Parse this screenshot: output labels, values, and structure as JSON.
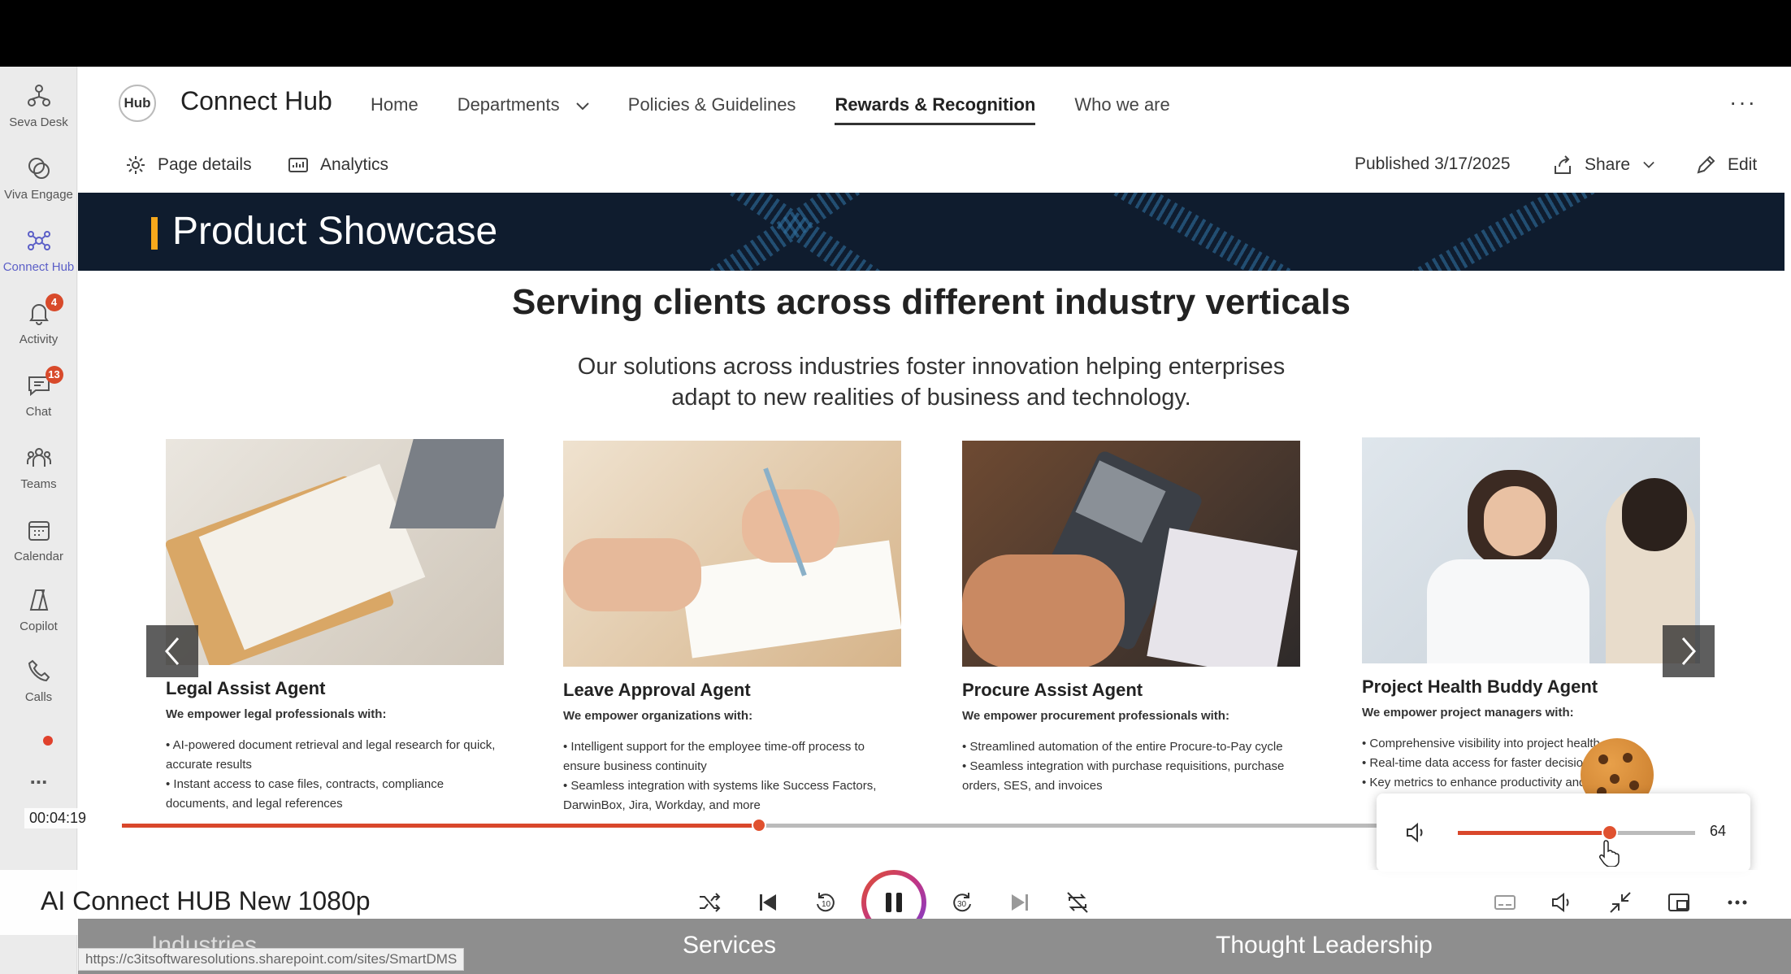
{
  "rail": {
    "items": [
      {
        "label": "Seva Desk"
      },
      {
        "label": "Viva Engage"
      },
      {
        "label": "Connect Hub"
      },
      {
        "label": "Activity",
        "badge": "4"
      },
      {
        "label": "Chat",
        "badge": "13"
      },
      {
        "label": "Teams"
      },
      {
        "label": "Calendar"
      },
      {
        "label": "Copilot"
      },
      {
        "label": "Calls"
      },
      {
        "label": "..."
      }
    ],
    "active": "Connect Hub"
  },
  "site": {
    "logo_text": "Hub",
    "title": "Connect Hub",
    "nav": {
      "home": "Home",
      "departments": "Departments",
      "policies": "Policies & Guidelines",
      "rewards": "Rewards & Recognition",
      "who": "Who we are"
    },
    "more": "···"
  },
  "commandbar": {
    "page_details": "Page details",
    "analytics": "Analytics",
    "published": "Published 3/17/2025",
    "share": "Share",
    "edit": "Edit"
  },
  "banner": {
    "title": "Product Showcase"
  },
  "showcase": {
    "headline": "Serving clients across different industry verticals",
    "subhead_line1": "Our solutions across industries foster innovation helping enterprises",
    "subhead_line2": "adapt to new realities of business and technology.",
    "cards": [
      {
        "title": "Legal Assist Agent",
        "lead": "We empower legal professionals with:",
        "bullets": [
          "AI-powered document retrieval and legal research for quick, accurate results",
          "Instant access to case files, contracts, compliance documents, and legal references"
        ]
      },
      {
        "title": "Leave Approval Agent",
        "lead": "We empower organizations with:",
        "bullets": [
          "Intelligent support for the employee time-off process to ensure business continuity",
          "Seamless integration with systems like Success Factors, DarwinBox, Jira, Workday, and more"
        ]
      },
      {
        "title": "Procure Assist Agent",
        "lead": "We empower procurement professionals with:",
        "bullets": [
          "Streamlined automation of the entire Procure-to-Pay cycle",
          "Seamless integration with purchase requisitions, purchase orders, SES, and invoices"
        ]
      },
      {
        "title": "Project Health Buddy Agent",
        "lead": "We empower project managers with:",
        "bullets": [
          "Comprehensive visibility into project health",
          "Real-time data access for faster decisions",
          "Key metrics to enhance productivity and efficiency"
        ]
      }
    ]
  },
  "player": {
    "current_time": "00:04:19",
    "progress": 0.506,
    "volume": 64,
    "volume_label": "64",
    "title": "AI Connect HUB New 1080p",
    "skip_back_label": "10",
    "skip_forward_label": "30"
  },
  "footer": {
    "industries": "Industries",
    "services": "Services",
    "thought": "Thought Leadership"
  },
  "status_url": "https://c3itsoftwaresolutions.sharepoint.com/sites/SmartDMS",
  "colors": {
    "accent": "#d9472b",
    "banner": "#0f1c2e",
    "teams_purple": "#5b5fc7",
    "banner_bar": "#f6a81c"
  }
}
